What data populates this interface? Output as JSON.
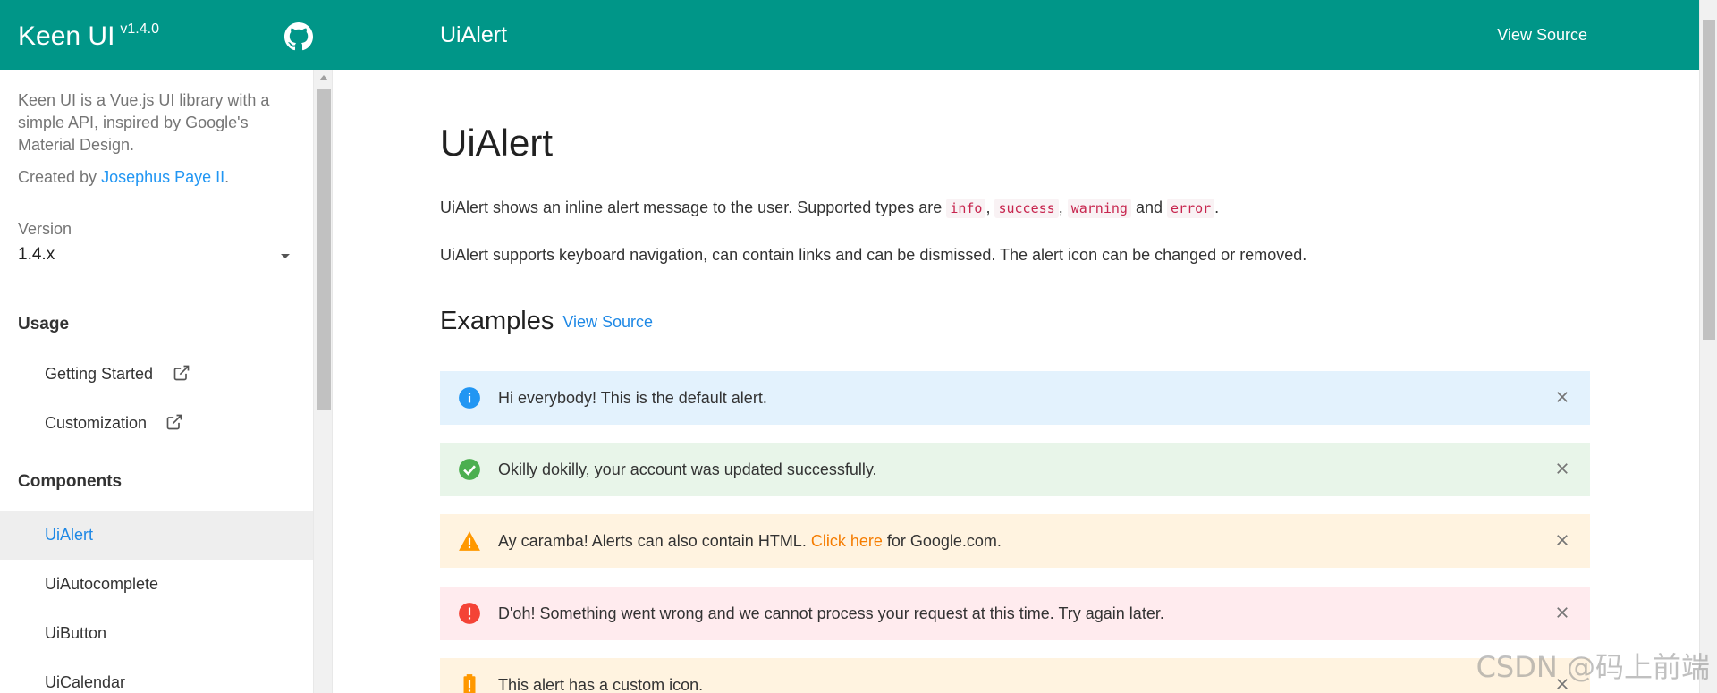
{
  "header": {
    "brand": "Keen UI",
    "version": "v1.4.0",
    "page_title": "UiAlert",
    "view_source": "View Source"
  },
  "sidebar": {
    "description": "Keen UI is a Vue.js UI library with a simple API, inspired by Google's Material Design.",
    "created_by_prefix": "Created by ",
    "author": "Josephus Paye II",
    "created_by_suffix": ".",
    "version_label": "Version",
    "version_value": "1.4.x",
    "usage_title": "Usage",
    "usage_items": [
      {
        "label": "Getting Started"
      },
      {
        "label": "Customization"
      }
    ],
    "components_title": "Components",
    "component_items": [
      {
        "label": "UiAlert",
        "active": true
      },
      {
        "label": "UiAutocomplete"
      },
      {
        "label": "UiButton"
      },
      {
        "label": "UiCalendar"
      }
    ]
  },
  "main": {
    "title": "UiAlert",
    "intro_prefix": "UiAlert shows an inline alert message to the user. Supported types are ",
    "types": [
      "info",
      "success",
      "warning",
      "error"
    ],
    "comma": ",",
    "and": "and",
    "period": ".",
    "intro2": "UiAlert supports keyboard navigation, can contain links and can be dismissed. The alert icon can be changed or removed.",
    "examples_title": "Examples",
    "examples_link": "View Source",
    "alerts": [
      {
        "type": "info",
        "message": "Hi everybody! This is the default alert.",
        "icon": "info-icon"
      },
      {
        "type": "success",
        "message": "Okilly dokilly, your account was updated successfully.",
        "icon": "check-circle-icon"
      },
      {
        "type": "warning",
        "message_prefix": "Ay caramba! Alerts can also contain HTML. ",
        "link": "Click here",
        "message_suffix": " for Google.com.",
        "icon": "warning-icon"
      },
      {
        "type": "error",
        "message": "D'oh! Something went wrong and we cannot process your request at this time. Try again later.",
        "icon": "error-icon"
      },
      {
        "type": "custom",
        "message": "This alert has a custom icon.",
        "icon": "battery-alert-icon"
      }
    ]
  },
  "watermark": "CSDN @码上前端",
  "colors": {
    "header": "#009688",
    "link": "#1e88e5",
    "info": "#2196f3",
    "success": "#4caf50",
    "warning": "#ff9800",
    "error": "#f44336"
  }
}
